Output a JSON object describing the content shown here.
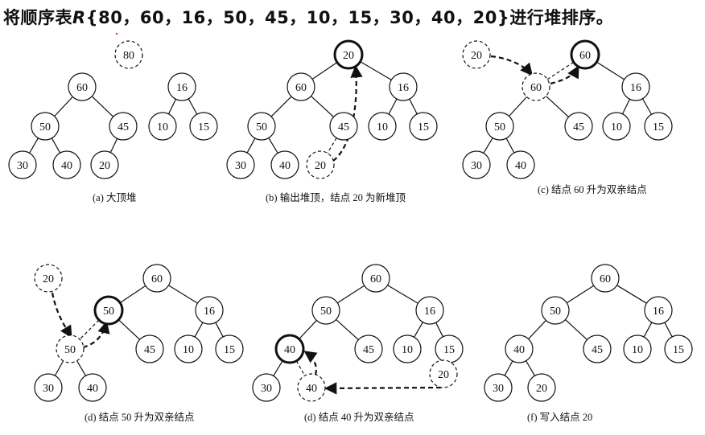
{
  "title": {
    "prefix": "将顺序表",
    "var": "R",
    "list": "{80，60，16，50，45，10，15，30，40，20}",
    "suffix": "进行堆排序。"
  },
  "panels": [
    {
      "id": "a",
      "caption": "(a)  大顶堆",
      "nodes": [
        {
          "id": "n80",
          "label": "80",
          "style": "dashed"
        },
        {
          "id": "n60",
          "label": "60",
          "style": "normal"
        },
        {
          "id": "n16",
          "label": "16",
          "style": "normal"
        },
        {
          "id": "n50",
          "label": "50",
          "style": "normal"
        },
        {
          "id": "n45",
          "label": "45",
          "style": "normal"
        },
        {
          "id": "n10",
          "label": "10",
          "style": "normal"
        },
        {
          "id": "n15",
          "label": "15",
          "style": "normal"
        },
        {
          "id": "n30",
          "label": "30",
          "style": "normal"
        },
        {
          "id": "n40",
          "label": "40",
          "style": "normal"
        },
        {
          "id": "n20",
          "label": "20",
          "style": "normal"
        }
      ]
    },
    {
      "id": "b",
      "caption": "(b)  输出堆顶，结点 20 为新堆顶",
      "nodes": [
        {
          "id": "top",
          "label": "20",
          "style": "bold"
        },
        {
          "id": "n60",
          "label": "60",
          "style": "normal"
        },
        {
          "id": "n16",
          "label": "16",
          "style": "normal"
        },
        {
          "id": "n50",
          "label": "50",
          "style": "normal"
        },
        {
          "id": "n45",
          "label": "45",
          "style": "normal"
        },
        {
          "id": "n10",
          "label": "10",
          "style": "normal"
        },
        {
          "id": "n15",
          "label": "15",
          "style": "normal"
        },
        {
          "id": "n30",
          "label": "30",
          "style": "normal"
        },
        {
          "id": "n40",
          "label": "40",
          "style": "normal"
        },
        {
          "id": "old20",
          "label": "20",
          "style": "dashed"
        }
      ]
    },
    {
      "id": "c",
      "caption": "(c)  结点 60 升为双亲结点",
      "nodes": [
        {
          "id": "top",
          "label": "60",
          "style": "bold"
        },
        {
          "id": "float20",
          "label": "20",
          "style": "dashed"
        },
        {
          "id": "slot",
          "label": "60",
          "style": "dashed"
        },
        {
          "id": "n16",
          "label": "16",
          "style": "normal"
        },
        {
          "id": "n50",
          "label": "50",
          "style": "normal"
        },
        {
          "id": "n45",
          "label": "45",
          "style": "normal"
        },
        {
          "id": "n10",
          "label": "10",
          "style": "normal"
        },
        {
          "id": "n15",
          "label": "15",
          "style": "normal"
        },
        {
          "id": "n30",
          "label": "30",
          "style": "normal"
        },
        {
          "id": "n40",
          "label": "40",
          "style": "normal"
        }
      ]
    },
    {
      "id": "d1",
      "caption": "(d)  结点 50 升为双亲结点",
      "nodes": [
        {
          "id": "top",
          "label": "60",
          "style": "normal"
        },
        {
          "id": "float20",
          "label": "20",
          "style": "dashed"
        },
        {
          "id": "n50",
          "label": "50",
          "style": "bold"
        },
        {
          "id": "n16",
          "label": "16",
          "style": "normal"
        },
        {
          "id": "slot",
          "label": "50",
          "style": "dashed"
        },
        {
          "id": "n45",
          "label": "45",
          "style": "normal"
        },
        {
          "id": "n10",
          "label": "10",
          "style": "normal"
        },
        {
          "id": "n15",
          "label": "15",
          "style": "normal"
        },
        {
          "id": "n30",
          "label": "30",
          "style": "normal"
        },
        {
          "id": "n40",
          "label": "40",
          "style": "normal"
        }
      ]
    },
    {
      "id": "d2",
      "caption": "(d)  结点 40 升为双亲结点",
      "nodes": [
        {
          "id": "top",
          "label": "60",
          "style": "normal"
        },
        {
          "id": "n50",
          "label": "50",
          "style": "normal"
        },
        {
          "id": "n16",
          "label": "16",
          "style": "normal"
        },
        {
          "id": "n40up",
          "label": "40",
          "style": "bold"
        },
        {
          "id": "n45",
          "label": "45",
          "style": "normal"
        },
        {
          "id": "n10",
          "label": "10",
          "style": "normal"
        },
        {
          "id": "n15",
          "label": "15",
          "style": "normal"
        },
        {
          "id": "n30",
          "label": "30",
          "style": "normal"
        },
        {
          "id": "slot",
          "label": "40",
          "style": "dashed"
        },
        {
          "id": "float20",
          "label": "20",
          "style": "dashed"
        }
      ]
    },
    {
      "id": "f",
      "caption": "(f)  写入结点 20",
      "nodes": [
        {
          "id": "top",
          "label": "60",
          "style": "normal"
        },
        {
          "id": "n50",
          "label": "50",
          "style": "normal"
        },
        {
          "id": "n16",
          "label": "16",
          "style": "normal"
        },
        {
          "id": "n40",
          "label": "40",
          "style": "normal"
        },
        {
          "id": "n45",
          "label": "45",
          "style": "normal"
        },
        {
          "id": "n10",
          "label": "10",
          "style": "normal"
        },
        {
          "id": "n15",
          "label": "15",
          "style": "normal"
        },
        {
          "id": "n30",
          "label": "30",
          "style": "normal"
        },
        {
          "id": "n20",
          "label": "20",
          "style": "normal"
        }
      ]
    }
  ]
}
